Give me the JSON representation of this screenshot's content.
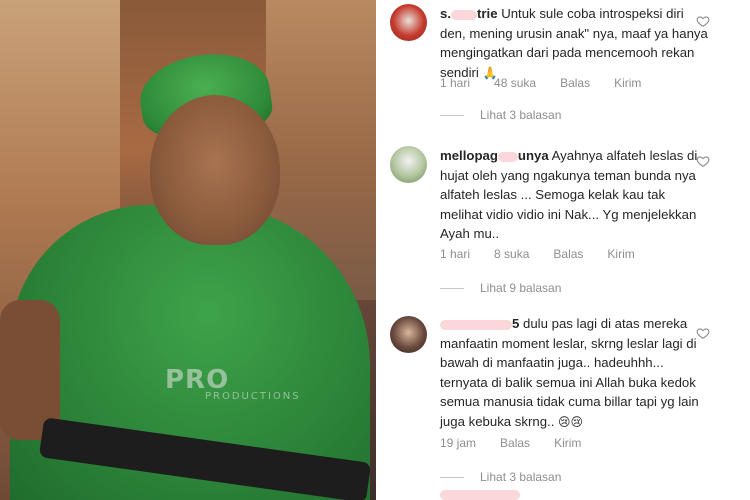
{
  "photo": {
    "watermark_main": "PRO",
    "watermark_sub": "PRODUCTIONS"
  },
  "comments": [
    {
      "username_visible": "trie",
      "username_prefix": "s.",
      "text": "Untuk sule coba introspeksi diri den, mening urusin anak\" nya, maaf ya hanya mengingatkan dari pada mencemooh rekan sendiri",
      "emoji": "🙏",
      "time": "1 hari",
      "likes": "48 suka",
      "reply_label": "Balas",
      "send_label": "Kirim",
      "view_replies": "Lihat 3 balasan"
    },
    {
      "username_visible": "unya",
      "username_prefix": "mellopag",
      "text": "Ayahnya alfateh leslas di hujat oleh yang ngakunya teman bunda nya alfateh leslas ... Semoga kelak kau tak melihat vidio vidio ini Nak... Yg menjelekkan Ayah mu..",
      "time": "1 hari",
      "likes": "8 suka",
      "reply_label": "Balas",
      "send_label": "Kirim",
      "view_replies": "Lihat 9 balasan"
    },
    {
      "username_visible": "5",
      "text": "dulu pas lagi di atas mereka manfaatin moment leslar, skrng leslar lagi di bawah di manfaatin juga.. hadeuhhh... ternyata di balik semua ini Allah buka kedok semua manusia tidak cuma billar tapi yg lain juga kebuka skrng..",
      "emoji": "😢😢",
      "time": "19 jam",
      "reply_label": "Balas",
      "send_label": "Kirim",
      "view_replies": "Lihat 3 balasan"
    }
  ],
  "colors": {
    "text": "#262626",
    "meta": "#8e8e8e",
    "mask": "#fbd7d9"
  },
  "icons": {
    "like": "heart-icon"
  }
}
